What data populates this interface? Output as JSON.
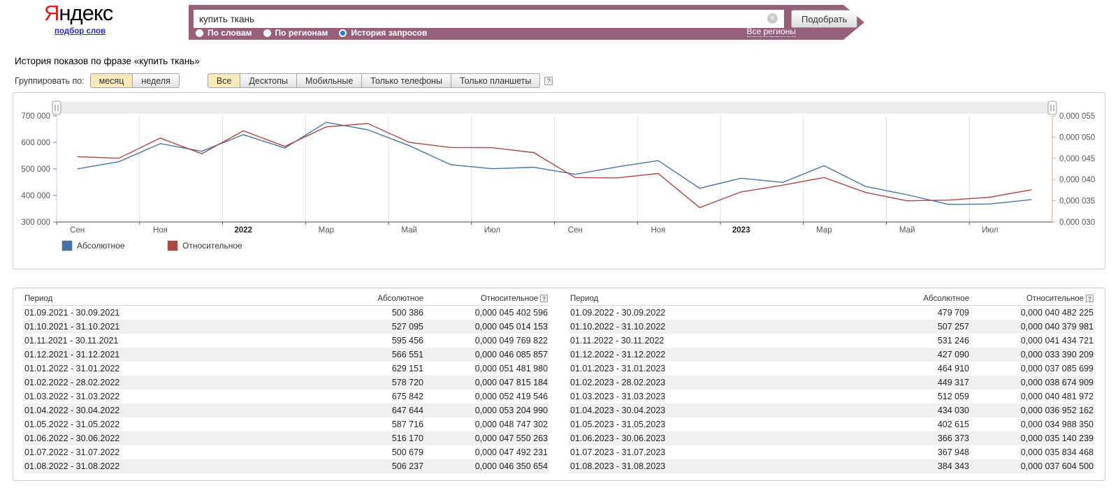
{
  "header": {
    "logo": {
      "first_letter": "Я",
      "rest": "ндекс",
      "sub_link": "подбор слов"
    },
    "search": {
      "value": "купить ткань",
      "submit_label": "Подобрать",
      "clear_icon": "✕"
    },
    "modes": [
      {
        "label": "По словам",
        "selected": false
      },
      {
        "label": "По регионам",
        "selected": false
      },
      {
        "label": "История запросов",
        "selected": true
      }
    ],
    "regions_link": "Все регионы",
    "banner_color": "#96607a"
  },
  "page": {
    "title": "История показов по фразе «купить ткань»"
  },
  "controls": {
    "group_label": "Группировать по:",
    "group_options": [
      {
        "label": "месяц",
        "selected": true
      },
      {
        "label": "неделя",
        "selected": false
      }
    ],
    "device_options": [
      {
        "label": "Все",
        "selected": true
      },
      {
        "label": "Десктопы",
        "selected": false
      },
      {
        "label": "Мобильные",
        "selected": false
      },
      {
        "label": "Только телефоны",
        "selected": false
      },
      {
        "label": "Только планшеты",
        "selected": false
      }
    ],
    "help_icon": "?"
  },
  "chart_data": {
    "type": "line",
    "n_points": 24,
    "x_tick_every": 2,
    "x_labels_visible": [
      "Сен",
      "Ноя",
      "2022",
      "Мар",
      "Май",
      "Июл",
      "Сен",
      "Ноя",
      "2023",
      "Мар",
      "Май",
      "Июл"
    ],
    "left_axis": {
      "min": 300000,
      "max": 700000,
      "step": 100000,
      "labels": [
        "700 000",
        "600 000",
        "500 000",
        "400 000",
        "300 000"
      ],
      "color": "#c3c8de"
    },
    "right_axis": {
      "min": 3e-05,
      "max": 5.5e-05,
      "step": 5e-06,
      "labels": [
        "0,000 055",
        "0,000 050",
        "0,000 045",
        "0,000 040",
        "0,000 035",
        "0,000 030"
      ],
      "color": "#dfa4a0"
    },
    "series": [
      {
        "name": "Абсолютное",
        "color": "#4572A7",
        "axis": "left",
        "values": [
          500386,
          527095,
          595456,
          566551,
          629151,
          578720,
          675842,
          647644,
          587716,
          516170,
          500679,
          506237,
          479709,
          507257,
          531246,
          427090,
          464910,
          449317,
          512059,
          434030,
          402615,
          366373,
          367948,
          384343
        ]
      },
      {
        "name": "Относительное",
        "color": "#AA4643",
        "axis": "right",
        "values": [
          4.5402596e-05,
          4.5014153e-05,
          4.9769822e-05,
          4.6085857e-05,
          5.148198e-05,
          4.7815184e-05,
          5.2419546e-05,
          5.320499e-05,
          4.8747302e-05,
          4.7550263e-05,
          4.7492231e-05,
          4.6350654e-05,
          4.0482225e-05,
          4.0379981e-05,
          4.1434721e-05,
          3.3390209e-05,
          3.7085699e-05,
          3.8674909e-05,
          4.0481972e-05,
          3.6952162e-05,
          3.498835e-05,
          3.5140239e-05,
          3.5834468e-05,
          3.76045e-05
        ]
      }
    ],
    "legend_position": "bottom-left",
    "grid": true
  },
  "tables": {
    "columns": [
      "Период",
      "Абсолютное",
      "Относительное"
    ],
    "help_icon": "?",
    "left": {
      "rows": [
        [
          "01.09.2021 - 30.09.2021",
          "500 386",
          "0,000 045 402 596"
        ],
        [
          "01.10.2021 - 31.10.2021",
          "527 095",
          "0,000 045 014 153"
        ],
        [
          "01.11.2021 - 30.11.2021",
          "595 456",
          "0,000 049 769 822"
        ],
        [
          "01.12.2021 - 31.12.2021",
          "566 551",
          "0,000 046 085 857"
        ],
        [
          "01.01.2022 - 31.01.2022",
          "629 151",
          "0,000 051 481 980"
        ],
        [
          "01.02.2022 - 28.02.2022",
          "578 720",
          "0,000 047 815 184"
        ],
        [
          "01.03.2022 - 31.03.2022",
          "675 842",
          "0,000 052 419 546"
        ],
        [
          "01.04.2022 - 30.04.2022",
          "647 644",
          "0,000 053 204 990"
        ],
        [
          "01.05.2022 - 31.05.2022",
          "587 716",
          "0,000 048 747 302"
        ],
        [
          "01.06.2022 - 30.06.2022",
          "516 170",
          "0,000 047 550 263"
        ],
        [
          "01.07.2022 - 31.07.2022",
          "500 679",
          "0,000 047 492 231"
        ],
        [
          "01.08.2022 - 31.08.2022",
          "506 237",
          "0,000 046 350 654"
        ]
      ]
    },
    "right": {
      "rows": [
        [
          "01.09.2022 - 30.09.2022",
          "479 709",
          "0,000 040 482 225"
        ],
        [
          "01.10.2022 - 31.10.2022",
          "507 257",
          "0,000 040 379 981"
        ],
        [
          "01.11.2022 - 30.11.2022",
          "531 246",
          "0,000 041 434 721"
        ],
        [
          "01.12.2022 - 31.12.2022",
          "427 090",
          "0,000 033 390 209"
        ],
        [
          "01.01.2023 - 31.01.2023",
          "464 910",
          "0,000 037 085 699"
        ],
        [
          "01.02.2023 - 28.02.2023",
          "449 317",
          "0,000 038 674 909"
        ],
        [
          "01.03.2023 - 31.03.2023",
          "512 059",
          "0,000 040 481 972"
        ],
        [
          "01.04.2023 - 30.04.2023",
          "434 030",
          "0,000 036 952 162"
        ],
        [
          "01.05.2023 - 31.05.2023",
          "402 615",
          "0,000 034 988 350"
        ],
        [
          "01.06.2023 - 30.06.2023",
          "366 373",
          "0,000 035 140 239"
        ],
        [
          "01.07.2023 - 31.07.2023",
          "367 948",
          "0,000 035 834 468"
        ],
        [
          "01.08.2023 - 31.08.2023",
          "384 343",
          "0,000 037 604 500"
        ]
      ]
    }
  }
}
